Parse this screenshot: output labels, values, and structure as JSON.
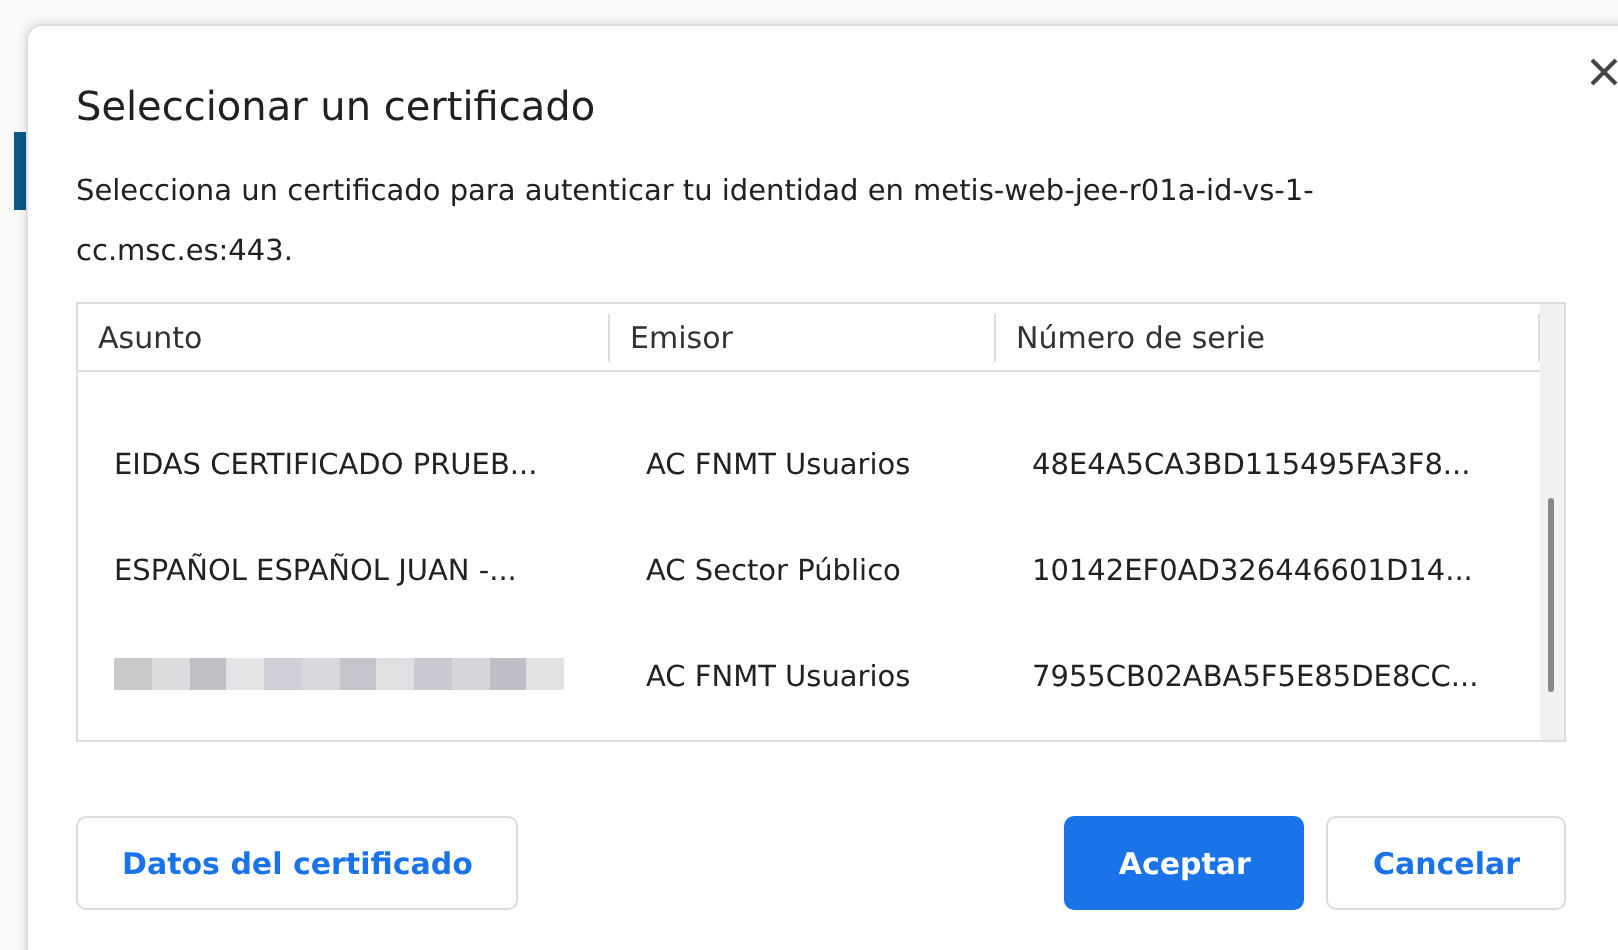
{
  "dialog": {
    "title": "Seleccionar un certificado",
    "message": "Selecciona un certificado para autenticar tu identidad en metis-web-jee-r01a-id-vs-1-cc.msc.es:443."
  },
  "table": {
    "columns": [
      "Asunto",
      "Emisor",
      "Número de serie"
    ],
    "rows": [
      {
        "kind": "text",
        "subject": "EIDAS CERTIFICADO PRUEB...",
        "issuer": "AC FNMT Usuarios",
        "serial": "48E4A5CA3BD115495FA3F8..."
      },
      {
        "kind": "text",
        "subject": "ESPAÑOL ESPAÑOL JUAN -...",
        "issuer": "AC Sector Público",
        "serial": "10142EF0AD326446601D14..."
      },
      {
        "kind": "redacted",
        "issuer": "AC FNMT Usuarios",
        "serial": "7955CB02ABA5F5E85DE8CC..."
      }
    ]
  },
  "buttons": {
    "details": "Datos del certificado",
    "accept": "Aceptar",
    "cancel": "Cancelar"
  }
}
